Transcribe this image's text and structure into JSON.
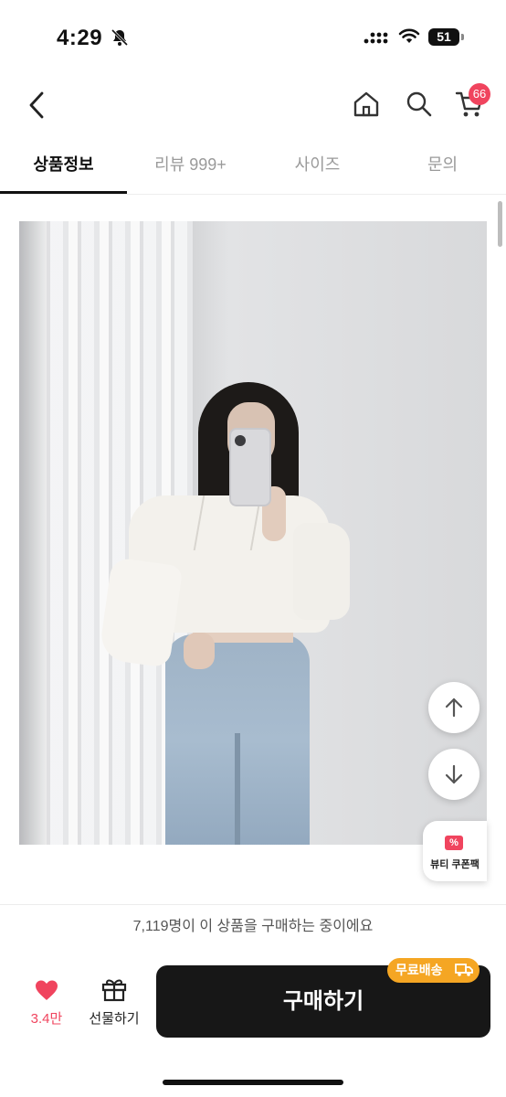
{
  "status": {
    "time": "4:29",
    "battery": "51"
  },
  "nav": {
    "cart_count": "66"
  },
  "tabs": [
    {
      "label": "상품정보",
      "active": true
    },
    {
      "label": "리뷰 999+",
      "active": false
    },
    {
      "label": "사이즈",
      "active": false
    },
    {
      "label": "문의",
      "active": false
    }
  ],
  "coupon": {
    "label": "뷰티 쿠폰팩"
  },
  "notice": {
    "text": "7,119명이 이 상품을 구매하는 중이에요"
  },
  "actions": {
    "like_count": "3.4만",
    "gift_label": "선물하기",
    "buy_label": "구매하기",
    "shipping_badge": "무료배송"
  },
  "colors": {
    "accent": "#f0445e",
    "buy_button": "#171717",
    "shipping": "#f5a623"
  },
  "icons": [
    "bell-slash-icon",
    "signal-icon",
    "wifi-icon",
    "back-icon",
    "home-icon",
    "search-icon",
    "cart-icon",
    "arrow-up-icon",
    "arrow-down-icon",
    "coupon-icon",
    "heart-icon",
    "gift-icon",
    "truck-icon"
  ]
}
